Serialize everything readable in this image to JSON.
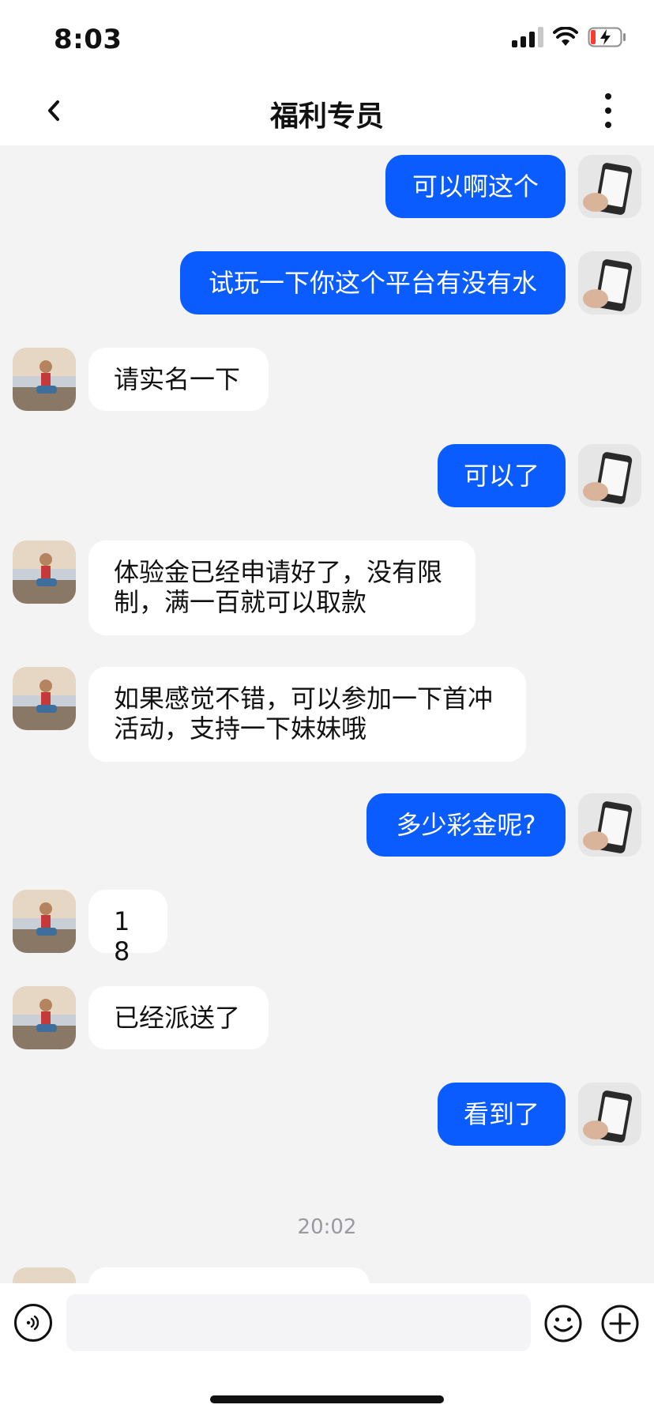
{
  "status_bar": {
    "time": "8:03",
    "icons": [
      "signal-icon",
      "wifi-icon",
      "battery-charging-icon"
    ]
  },
  "nav": {
    "title": "福利专员",
    "back_icon": "chevron-left-icon",
    "more_icon": "more-vertical-icon"
  },
  "messages": [
    {
      "sender": "me",
      "text": "可以啊这个"
    },
    {
      "sender": "me",
      "text": "试玩一下你这个平台有没有水"
    },
    {
      "sender": "them",
      "text": "请实名一下"
    },
    {
      "sender": "me",
      "text": "可以了"
    },
    {
      "sender": "them",
      "text": "体验金已经申请好了，没有限制，满一百就可以取款"
    },
    {
      "sender": "them",
      "text": "如果感觉不错，可以参加一下首冲活动，支持一下妹妹哦"
    },
    {
      "sender": "me",
      "text": "多少彩金呢?"
    },
    {
      "sender": "them",
      "text": "18"
    },
    {
      "sender": "them",
      "text": "已经派送了"
    },
    {
      "sender": "me",
      "text": "看到了"
    }
  ],
  "timestamp": "20:02",
  "input_bar": {
    "placeholder": "",
    "voice_icon": "voice-icon",
    "emoji_icon": "emoji-icon",
    "plus_icon": "plus-icon"
  },
  "colors": {
    "my_bubble": "#0a5cff",
    "their_bubble": "#ffffff",
    "chat_background": "#f3f3f4"
  }
}
